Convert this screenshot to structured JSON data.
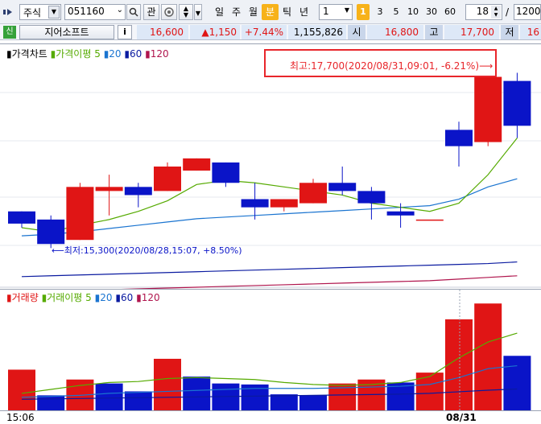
{
  "toolbar": {
    "market_type": "주식",
    "stock_code": "051160",
    "search_icon": "magnifier-icon",
    "watch_label": "관",
    "periods": [
      "일",
      "주",
      "월",
      "분",
      "틱",
      "년"
    ],
    "active_period": "분",
    "interval_value": "1",
    "minute_buttons": [
      "1",
      "3",
      "5",
      "10",
      "30",
      "60"
    ],
    "active_minute": "1",
    "count_value": "18",
    "slash": "/",
    "max_count": "1200"
  },
  "infobar": {
    "credit_badge": "신",
    "company_name": "지어소프트",
    "info_icon": "i",
    "price": "16,600",
    "change": "▲1,150",
    "change_pct": "+7.44%",
    "volume": "1,155,826",
    "open_label": "시",
    "open_value": "16,800",
    "high_label": "고",
    "high_value": "17,700",
    "low_label": "저",
    "low_value": "16"
  },
  "price_chart": {
    "legend_title": "가격차트",
    "ma_label": "가격이평",
    "ma_periods": [
      "5",
      "20",
      "60",
      "120"
    ],
    "high_annotation": "최고:17,700(2020/08/31,09:01, -6.21%)⟶",
    "low_annotation": "⟵최저:15,300(2020/08/28,15:07, +8.50%)"
  },
  "volume_chart": {
    "legend_title": "거래량",
    "ma_label": "거래이평",
    "ma_periods": [
      "5",
      "20",
      "60",
      "120"
    ]
  },
  "x_axis": {
    "left_label": "15:06",
    "right_label": "08/31"
  },
  "colors": {
    "up": "#e01515",
    "down": "#0a14c8",
    "ma5": "#55aa00",
    "ma20": "#1a74d0",
    "ma60": "#0a1aa0",
    "ma120": "#b0154d"
  },
  "chart_data": {
    "type": "candlestick",
    "ylim": [
      15000,
      18000
    ],
    "candles": [
      {
        "o": 15950,
        "h": 15950,
        "l": 15750,
        "c": 15800
      },
      {
        "o": 15850,
        "h": 15900,
        "l": 15500,
        "c": 15550
      },
      {
        "o": 15600,
        "h": 16300,
        "l": 15600,
        "c": 16250
      },
      {
        "o": 16200,
        "h": 16400,
        "l": 15900,
        "c": 16250
      },
      {
        "o": 16250,
        "h": 16300,
        "l": 16000,
        "c": 16150
      },
      {
        "o": 16200,
        "h": 16550,
        "l": 16200,
        "c": 16500
      },
      {
        "o": 16450,
        "h": 16600,
        "l": 16450,
        "c": 16600
      },
      {
        "o": 16550,
        "h": 16550,
        "l": 16250,
        "c": 16300
      },
      {
        "o": 16100,
        "h": 16300,
        "l": 15850,
        "c": 16000
      },
      {
        "o": 16000,
        "h": 16100,
        "l": 15950,
        "c": 16100
      },
      {
        "o": 16050,
        "h": 16350,
        "l": 16050,
        "c": 16300
      },
      {
        "o": 16300,
        "h": 16500,
        "l": 16150,
        "c": 16200
      },
      {
        "o": 16200,
        "h": 16250,
        "l": 15850,
        "c": 16050
      },
      {
        "o": 15950,
        "h": 16050,
        "l": 15750,
        "c": 15900
      },
      {
        "o": 15850,
        "h": 15850,
        "l": 15850,
        "c": 15850
      },
      {
        "o": 16950,
        "h": 17050,
        "l": 16500,
        "c": 16750
      },
      {
        "o": 16800,
        "h": 17700,
        "l": 16750,
        "c": 17600
      },
      {
        "o": 17550,
        "h": 17650,
        "l": 16850,
        "c": 17000
      }
    ],
    "volume_ylim": [
      0,
      550000
    ],
    "volume": [
      {
        "v": 210000,
        "up": true
      },
      {
        "v": 80000,
        "up": false
      },
      {
        "v": 160000,
        "up": true
      },
      {
        "v": 140000,
        "up": false
      },
      {
        "v": 100000,
        "up": false
      },
      {
        "v": 265000,
        "up": true
      },
      {
        "v": 175000,
        "up": false
      },
      {
        "v": 140000,
        "up": false
      },
      {
        "v": 135000,
        "up": false
      },
      {
        "v": 85000,
        "up": false
      },
      {
        "v": 80000,
        "up": false
      },
      {
        "v": 140000,
        "up": true
      },
      {
        "v": 160000,
        "up": true
      },
      {
        "v": 145000,
        "up": false
      },
      {
        "v": 195000,
        "up": true
      },
      {
        "v": 465000,
        "up": true
      },
      {
        "v": 545000,
        "up": true
      },
      {
        "v": 280000,
        "up": false
      }
    ],
    "price_ma5": [
      15750,
      15700,
      15780,
      15850,
      15950,
      16080,
      16280,
      16330,
      16300,
      16250,
      16200,
      16150,
      16050,
      16000,
      15950,
      16050,
      16400,
      16850
    ],
    "price_ma20": [
      15650,
      15670,
      15700,
      15740,
      15780,
      15820,
      15860,
      15880,
      15900,
      15920,
      15940,
      15960,
      15980,
      16000,
      16020,
      16100,
      16250,
      16350
    ],
    "price_ma60": [
      15150,
      15160,
      15170,
      15180,
      15190,
      15200,
      15210,
      15220,
      15230,
      15240,
      15250,
      15260,
      15270,
      15280,
      15290,
      15300,
      15310,
      15330
    ],
    "price_ma120": [
      14950,
      14960,
      14975,
      14990,
      15000,
      15010,
      15020,
      15030,
      15040,
      15050,
      15060,
      15070,
      15080,
      15090,
      15100,
      15120,
      15140,
      15160
    ],
    "vol_ma5": [
      90000,
      110000,
      130000,
      145000,
      150000,
      165000,
      170000,
      165000,
      160000,
      145000,
      135000,
      130000,
      135000,
      145000,
      175000,
      270000,
      350000,
      395000
    ],
    "vol_ma20": [
      70000,
      75000,
      80000,
      90000,
      95000,
      100000,
      105000,
      110000,
      115000,
      115000,
      115000,
      118000,
      122000,
      126000,
      135000,
      170000,
      215000,
      230000
    ],
    "vol_ma60": [
      60000,
      62000,
      64000,
      66000,
      68000,
      70000,
      72000,
      74000,
      76000,
      78000,
      80000,
      82000,
      84000,
      86000,
      90000,
      98000,
      106000,
      112000
    ]
  }
}
